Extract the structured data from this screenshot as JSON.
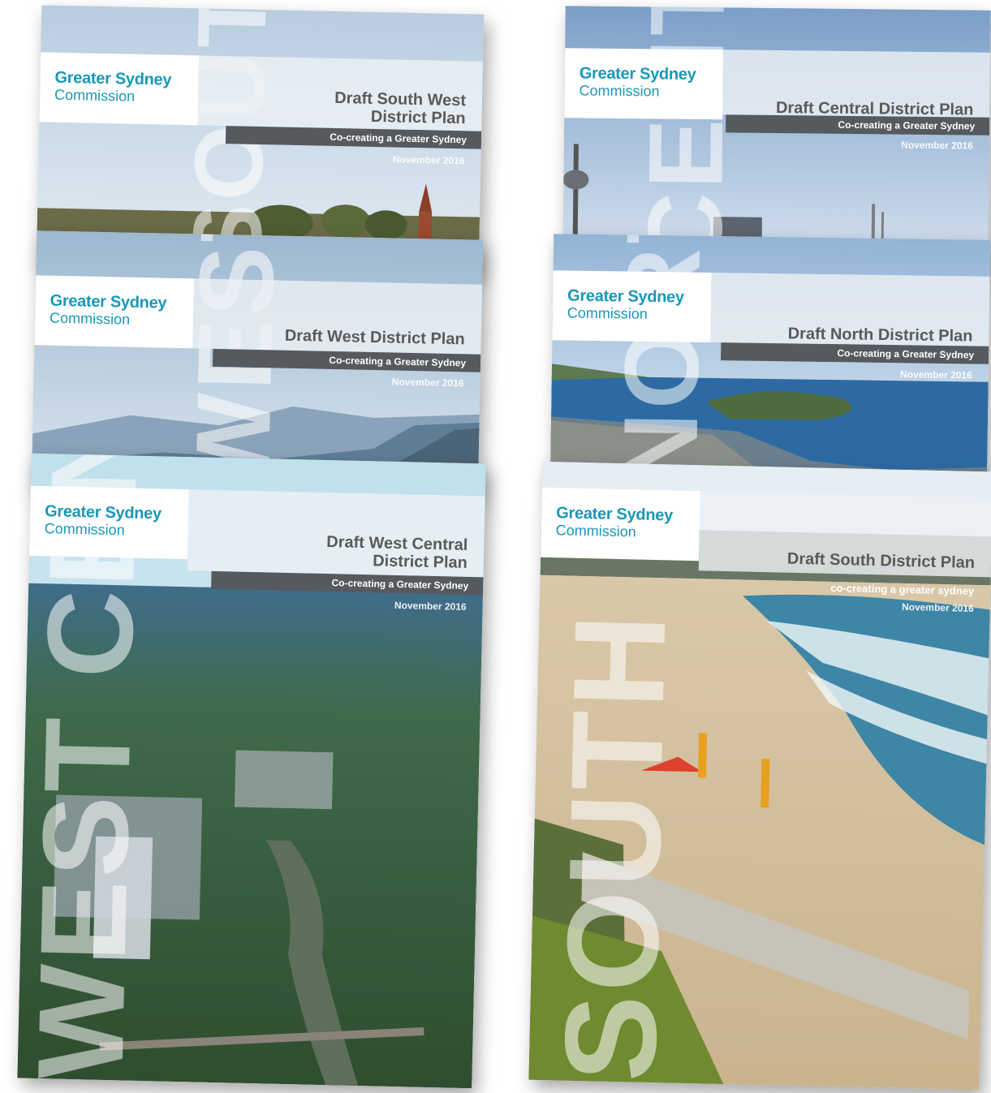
{
  "covers": [
    {
      "id": "south-west",
      "logo_line1": "Greater Sydney",
      "logo_line2": "Commission",
      "title": "Draft South West District Plan",
      "tagline": "Co-creating a Greater Sydney",
      "date": "November 2016",
      "watermark": "SOUTH WEST"
    },
    {
      "id": "central",
      "logo_line1": "Greater Sydney",
      "logo_line2": "Commission",
      "title": "Draft Central District Plan",
      "tagline": "Co-creating a Greater Sydney",
      "date": "November 2016",
      "watermark": "CENTRAL"
    },
    {
      "id": "west",
      "logo_line1": "Greater Sydney",
      "logo_line2": "Commission",
      "title": "Draft West District Plan",
      "tagline": "Co-creating a Greater Sydney",
      "date": "November 2016",
      "watermark": "WEST"
    },
    {
      "id": "north",
      "logo_line1": "Greater Sydney",
      "logo_line2": "Commission",
      "title": "Draft North District Plan",
      "tagline": "Co-creating a Greater Sydney",
      "date": "November 2016",
      "watermark": "NORTH"
    },
    {
      "id": "west-central",
      "logo_line1": "Greater Sydney",
      "logo_line2": "Commission",
      "title": "Draft West Central District Plan",
      "tagline": "Co-creating a Greater Sydney",
      "date": "November 2016",
      "watermark": "WEST CENTRAL"
    },
    {
      "id": "south",
      "logo_line1": "Greater Sydney",
      "logo_line2": "Commission",
      "title": "Draft South District Plan",
      "tagline": "co-creating a greater sydney",
      "date": "November 2016",
      "watermark": "SOUTH"
    }
  ],
  "colors": {
    "brand_teal": "#1a97b8",
    "bar_grey": "#555a5f",
    "title_grey": "#5a5a5a"
  }
}
